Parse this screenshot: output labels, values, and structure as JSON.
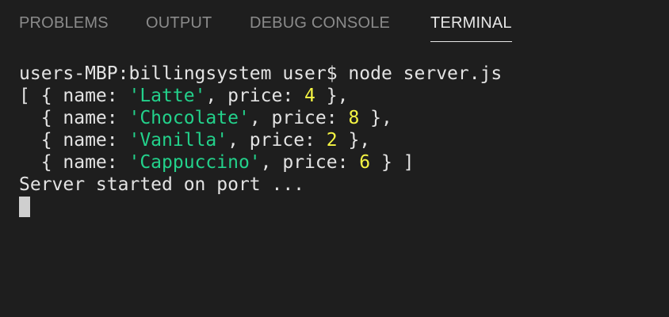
{
  "tabs": [
    {
      "label": "PROBLEMS",
      "active": false
    },
    {
      "label": "OUTPUT",
      "active": false
    },
    {
      "label": "DEBUG CONSOLE",
      "active": false
    },
    {
      "label": "TERMINAL",
      "active": true
    }
  ],
  "terminal": {
    "command_line": "users-MBP:billingsystem user$ node server.js",
    "output": {
      "items": [
        {
          "prefix": "[ { name: ",
          "name": "'Latte'",
          "mid": ", price: ",
          "price": "4",
          "suffix": " },"
        },
        {
          "prefix": "  { name: ",
          "name": "'Chocolate'",
          "mid": ", price: ",
          "price": "8",
          "suffix": " },"
        },
        {
          "prefix": "  { name: ",
          "name": "'Vanilla'",
          "mid": ", price: ",
          "price": "2",
          "suffix": " },"
        },
        {
          "prefix": "  { name: ",
          "name": "'Cappuccino'",
          "mid": ", price: ",
          "price": "6",
          "suffix": " } ]"
        }
      ],
      "status": "Server started on port ..."
    }
  },
  "colors": {
    "background": "#1e1e1e",
    "text": "#e3e3e3",
    "inactive_tab": "#8b8b8b",
    "active_tab": "#e7e7e7",
    "string": "#23d18b",
    "number": "#f5f543"
  }
}
